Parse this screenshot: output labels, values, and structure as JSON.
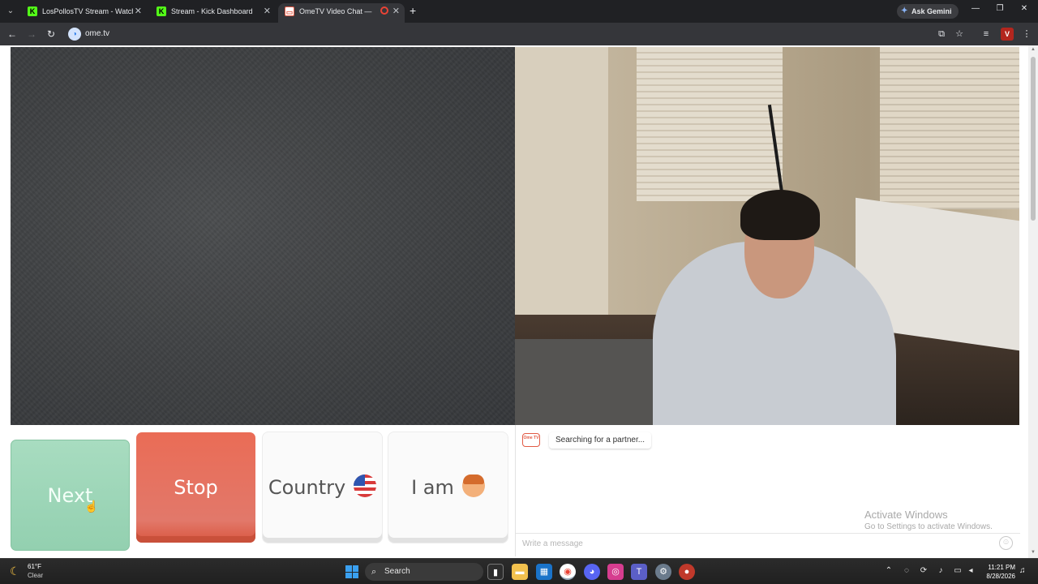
{
  "browser": {
    "tabs": [
      {
        "title": "LosPollosTV Stream - Watch Live",
        "favicon": "kick-icon",
        "active": false
      },
      {
        "title": "Stream - Kick Dashboard",
        "favicon": "kick-icon",
        "active": false
      },
      {
        "title": "OmeTV Video Chat — OmeTV",
        "favicon": "ometv-icon",
        "active": true
      }
    ],
    "new_tab": "+",
    "ask_gemini": "Ask Gemini",
    "url": "ome.tv"
  },
  "controls": {
    "next_label": "Next",
    "stop_label": "Stop",
    "country_label": "Country",
    "iam_label": "I am"
  },
  "chat": {
    "logo_text": "Ome TV",
    "status_message": "Searching for a partner...",
    "input_placeholder": "Write a message"
  },
  "watermark": {
    "line1": "Activate Windows",
    "line2": "Go to Settings to activate Windows."
  },
  "taskbar": {
    "weather_temp": "61°F",
    "weather_cond": "Clear",
    "search_label": "Search",
    "time": "11:21 PM",
    "date": "8/28/2026"
  },
  "colors": {
    "next": "#9fd6b9",
    "stop": "#e5604a",
    "ometv_brand": "#e25b45"
  }
}
